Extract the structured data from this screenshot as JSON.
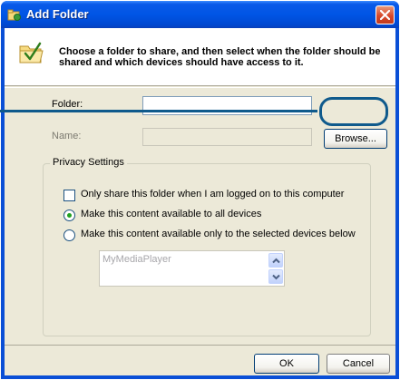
{
  "window": {
    "title": "Add Folder",
    "icons": {
      "title": "folder-share-icon",
      "close": "close-icon",
      "header": "folder-checkmark-icon"
    }
  },
  "header": {
    "text": "Choose a folder to share, and then select when the folder should be shared and which devices should have access to it."
  },
  "form": {
    "folder_label": "Folder:",
    "folder_value": "",
    "name_label": "Name:",
    "name_value": "",
    "browse_label": "Browse..."
  },
  "privacy": {
    "title": "Privacy Settings",
    "only_share_checkbox": {
      "label": "Only share this folder when I am logged on to this computer",
      "checked": false
    },
    "radio_all": {
      "label": "Make this content available to all devices",
      "selected": true
    },
    "radio_selected": {
      "label": "Make this content available only to the selected devices below",
      "selected": false
    },
    "devices": [
      "MyMediaPlayer"
    ]
  },
  "footer": {
    "ok_label": "OK",
    "cancel_label": "Cancel"
  },
  "colors": {
    "titlebar": "#0055e5",
    "dialog_bg": "#ece9d8",
    "callout": "#0f5a8c",
    "radio_dot": "#21a121"
  }
}
